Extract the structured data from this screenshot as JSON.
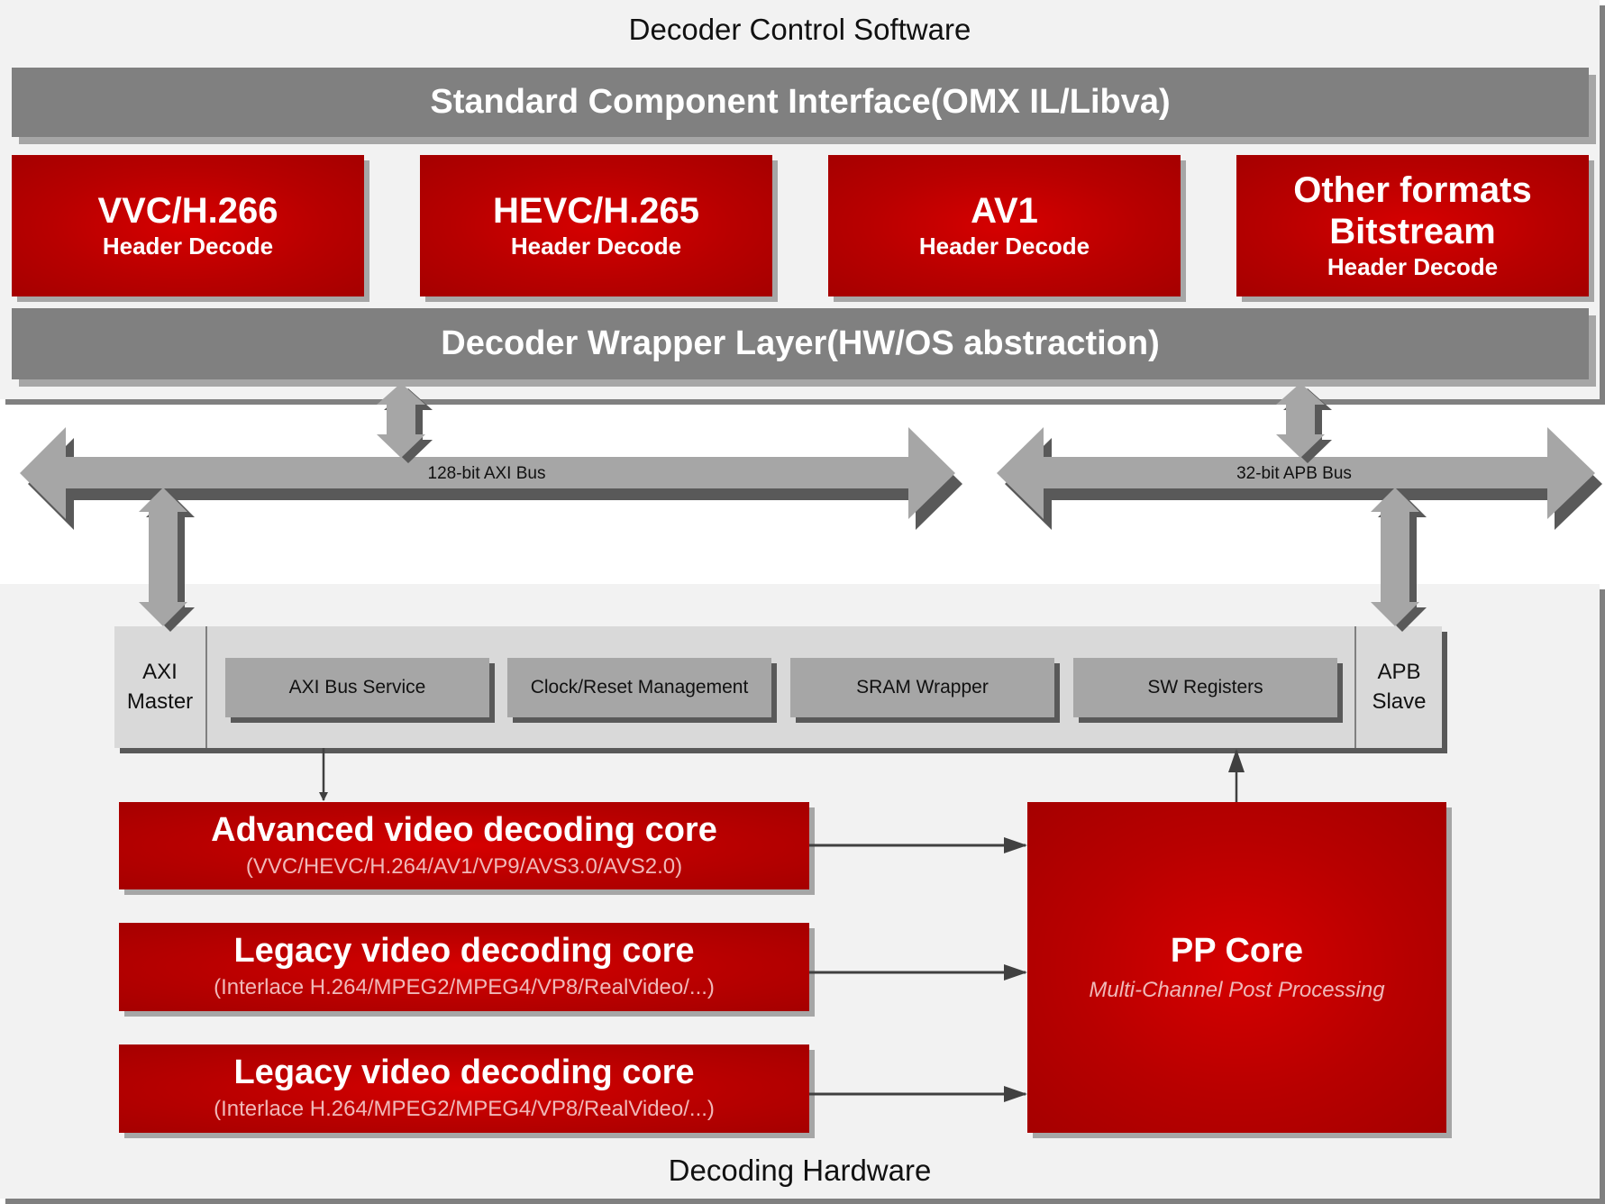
{
  "software": {
    "title": "Decoder Control Software",
    "standard_interface": "Standard Component Interface(OMX IL/Libva)",
    "header_decoders": [
      {
        "title": "VVC/H.266",
        "subtitle": "Header Decode"
      },
      {
        "title": "HEVC/H.265",
        "subtitle": "Header Decode"
      },
      {
        "title": "AV1",
        "subtitle": "Header Decode"
      },
      {
        "title": "Other formats Bitstream",
        "title_line1": "Other formats",
        "title_line2": "Bitstream",
        "subtitle": "Header Decode"
      }
    ],
    "wrapper_layer": "Decoder Wrapper Layer(HW/OS abstraction)"
  },
  "buses": {
    "axi": "128-bit AXI Bus",
    "apb": "32-bit APB Bus"
  },
  "hardware": {
    "title": "Decoding Hardware",
    "axi_master": {
      "line1": "AXI",
      "line2": "Master"
    },
    "apb_slave": {
      "line1": "APB",
      "line2": "Slave"
    },
    "interface_blocks": [
      "AXI Bus Service",
      "Clock/Reset Management",
      "SRAM Wrapper",
      "SW Registers"
    ],
    "cores": [
      {
        "title": "Advanced video decoding core",
        "subtitle": "(VVC/HEVC/H.264/AV1/VP9/AVS3.0/AVS2.0)"
      },
      {
        "title": "Legacy video decoding core",
        "subtitle": "(Interlace H.264/MPEG2/MPEG4/VP8/RealVideo/...)"
      },
      {
        "title": "Legacy video decoding core",
        "subtitle": "(Interlace H.264/MPEG2/MPEG4/VP8/RealVideo/...)"
      }
    ],
    "pp_core": {
      "title": "PP Core",
      "subtitle": "Multi-Channel Post Processing"
    }
  },
  "colors": {
    "accent_red": "#c00000",
    "bar_grey": "#808080",
    "bus_grey": "#a6a6a6",
    "panel_bg": "#f2f2f2"
  }
}
